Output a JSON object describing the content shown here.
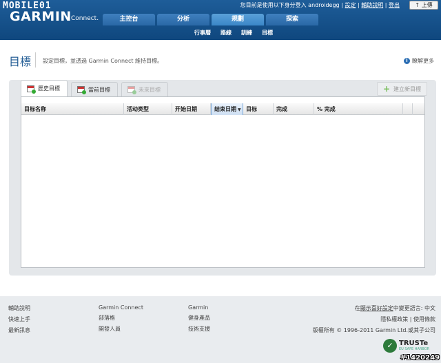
{
  "branding": {
    "mobile01_logo": "MOBILE01",
    "garmin_logo": "GARMIN",
    "connect_text": "Connect."
  },
  "userbar": {
    "login_text": "您目前是使用以下身分登入 androidegg",
    "settings_link": "設定",
    "help_link": "輔助說明",
    "logout_link": "登出",
    "upload_button": "上傳"
  },
  "main_nav": {
    "tabs": [
      {
        "label": "主控台",
        "active": false
      },
      {
        "label": "分析",
        "active": false
      },
      {
        "label": "規劃",
        "active": true
      },
      {
        "label": "探索",
        "active": false
      }
    ]
  },
  "sub_nav": {
    "items": [
      "行事曆",
      "路線",
      "訓練",
      "目標"
    ]
  },
  "page": {
    "title": "目標",
    "subtitle": "設定目標，並透過 Garmin Connect 維持目標。",
    "learn_more": "瞭解更多"
  },
  "goal_tabs": [
    {
      "label": "歷史目標",
      "state": "active"
    },
    {
      "label": "當前目標",
      "state": "normal"
    },
    {
      "label": "未來目標",
      "state": "disabled"
    }
  ],
  "new_goal_button": "建立新目標",
  "grid": {
    "columns": [
      "目标名称",
      "活动类型",
      "开始日期",
      "结束日期",
      "目标",
      "完成",
      "% 完成"
    ],
    "sorted_column": "结束日期",
    "rows": []
  },
  "footer": {
    "col1": [
      "輔助說明",
      "快速上手",
      "最新訊息"
    ],
    "col2": [
      "Garmin Connect",
      "部落格",
      "開發人員"
    ],
    "col3": [
      "Garmin",
      "健身產品",
      "技術支援"
    ],
    "right_lang_prefix": "在",
    "right_lang_link": "顯示喜好設定",
    "right_lang_suffix": "中變更語言: 中文",
    "privacy": "隱私權政策 | 使用條款",
    "copyright": "版權所有 © 1996-2011 Garmin Ltd.或其子公司"
  },
  "truste": {
    "name": "TRUSTe",
    "sub": "EU SAFE HARBOR"
  },
  "watermark": "#1420249"
}
